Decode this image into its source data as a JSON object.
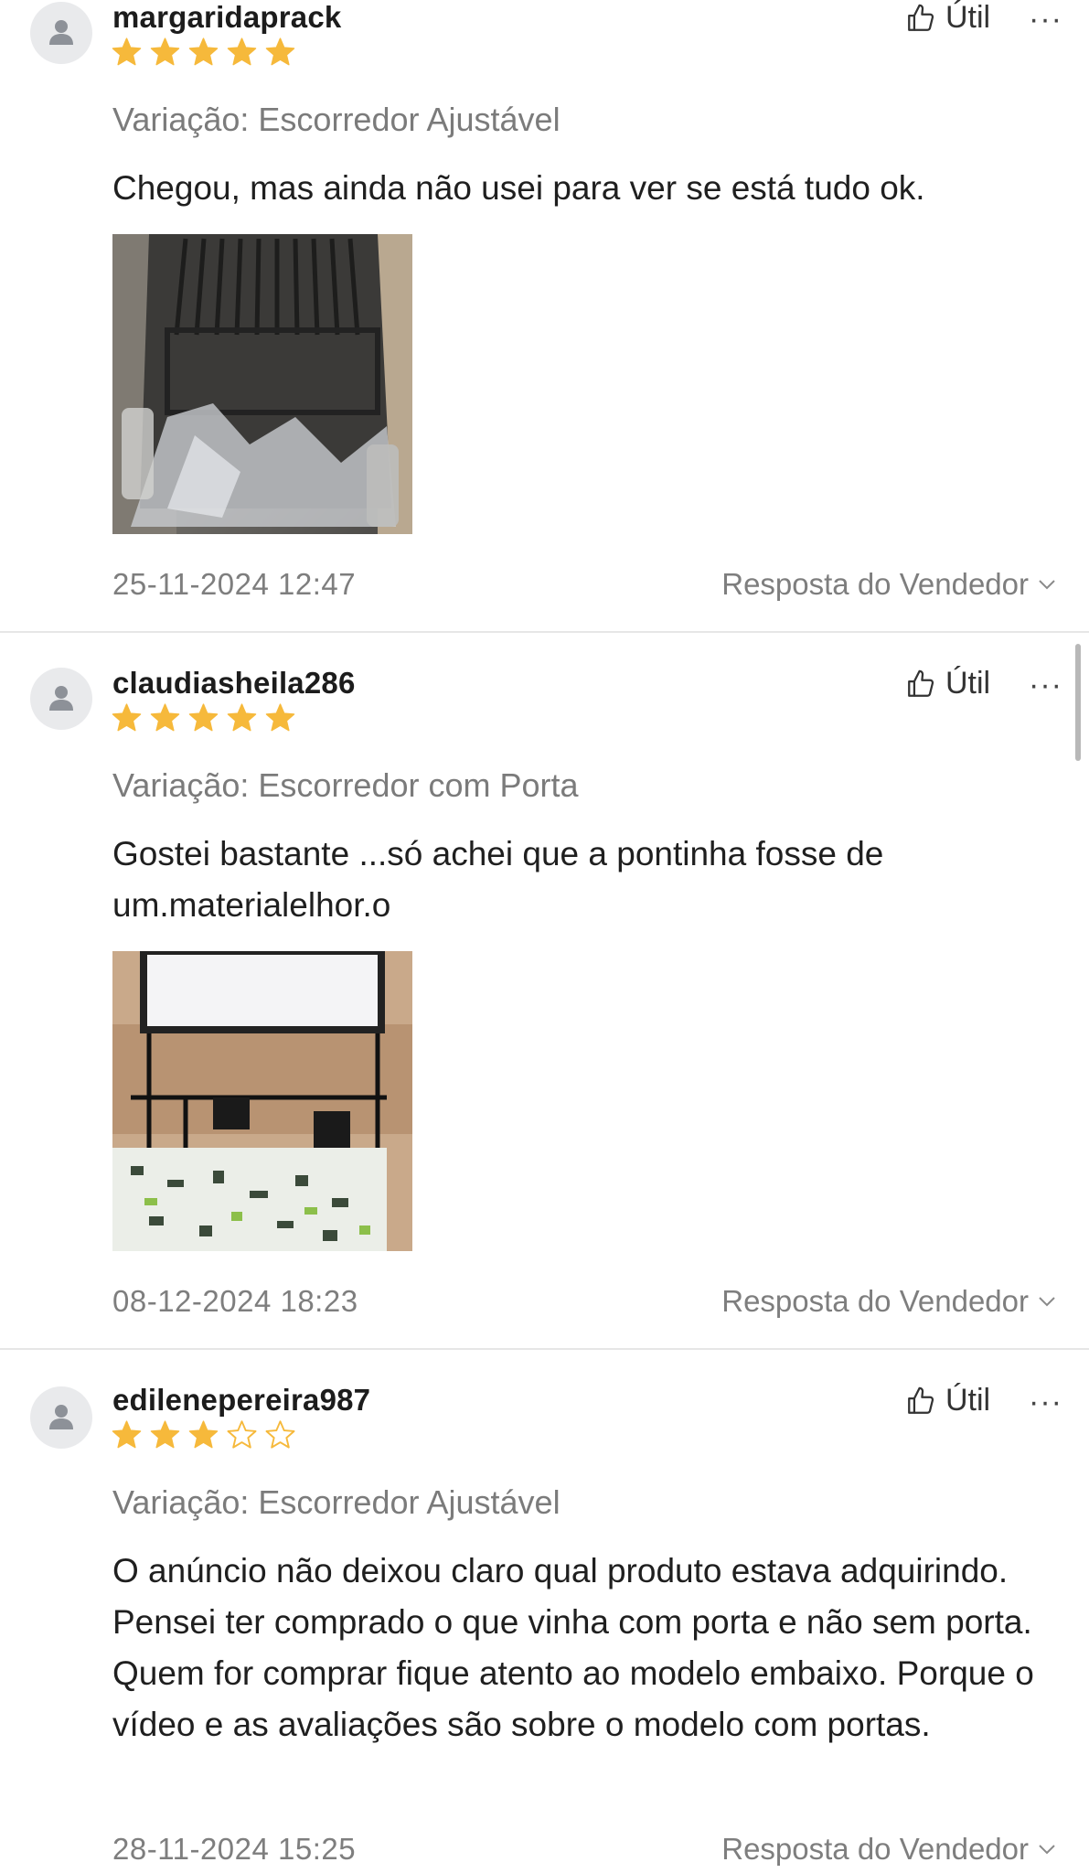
{
  "helpful_label": "Útil",
  "more_label": "···",
  "seller_reply_label": "Resposta do Vendedor",
  "colors": {
    "star_filled": "#f6b93b",
    "star_empty": "#f6b93b",
    "muted_text": "#7b7b7b"
  },
  "reviews": [
    {
      "username": "margaridaprack",
      "rating": 5,
      "variation": "Variação: Escorredor Ajustável",
      "text": "Chegou, mas ainda não usei para ver se está tudo ok.",
      "date": "25-11-2024 12:47"
    },
    {
      "username": "claudiasheila286",
      "rating": 5,
      "variation": "Variação: Escorredor com Porta",
      "text": "Gostei bastante ...só achei que a pontinha fosse de um.materialelhor.o",
      "date": "08-12-2024 18:23"
    },
    {
      "username": "edilenepereira987",
      "rating": 3,
      "variation": "Variação: Escorredor Ajustável",
      "text": "O anúncio não deixou claro qual produto estava adquirindo. Pensei ter comprado o que vinha com porta e não sem porta. Quem for comprar fique atento ao modelo embaixo. Porque o vídeo e as avaliações são sobre o modelo com portas.",
      "date": "28-11-2024 15:25"
    }
  ]
}
